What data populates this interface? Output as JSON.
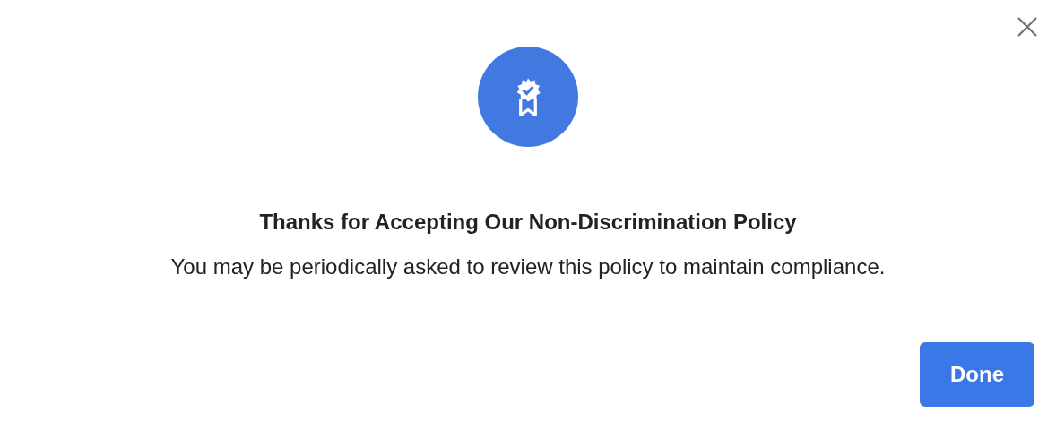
{
  "dialog": {
    "title": "Thanks for Accepting Our Non-Discrimination Policy",
    "message": "You may be periodically asked to review this policy to maintain compliance.",
    "buttons": [
      "Done"
    ]
  }
}
